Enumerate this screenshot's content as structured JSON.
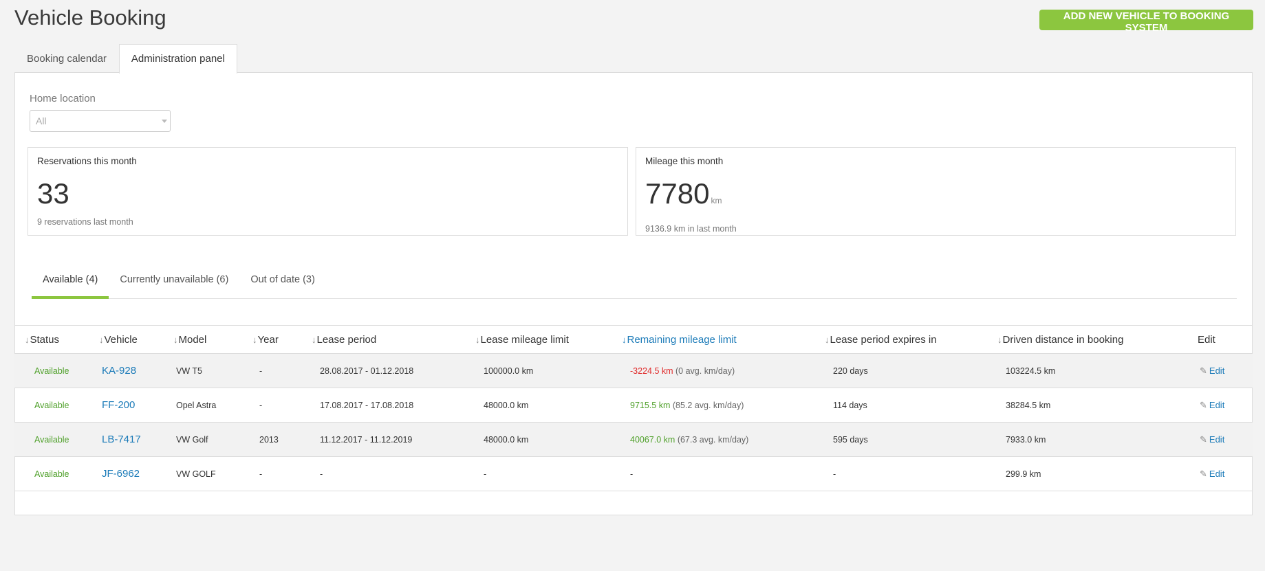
{
  "header": {
    "title": "Vehicle Booking",
    "add_button": "ADD NEW VEHICLE TO BOOKING SYSTEM"
  },
  "main_tabs": [
    {
      "label": "Booking calendar",
      "active": false
    },
    {
      "label": "Administration panel",
      "active": true
    }
  ],
  "filter": {
    "label": "Home location",
    "value": "All"
  },
  "stats": {
    "reservations": {
      "label": "Reservations this month",
      "value": "33",
      "sub": "9 reservations last month"
    },
    "mileage": {
      "label": "Mileage this month",
      "value": "7780",
      "unit": "km",
      "sub": "9136.9 km in last month"
    }
  },
  "sub_tabs": [
    {
      "label": "Available (4)",
      "active": true
    },
    {
      "label": "Currently unavailable (6)",
      "active": false
    },
    {
      "label": "Out of date (3)",
      "active": false
    }
  ],
  "table": {
    "sort_arrow": "↓",
    "columns": [
      {
        "label": "Status",
        "sortable": true
      },
      {
        "label": "Vehicle",
        "sortable": true
      },
      {
        "label": "Model",
        "sortable": true
      },
      {
        "label": "Year",
        "sortable": true
      },
      {
        "label": "Lease period",
        "sortable": true
      },
      {
        "label": "Lease mileage limit",
        "sortable": true
      },
      {
        "label": "Remaining mileage limit",
        "sortable": true,
        "sorted": true
      },
      {
        "label": "Lease period expires in",
        "sortable": true
      },
      {
        "label": "Driven distance in booking",
        "sortable": true
      },
      {
        "label": "Edit",
        "sortable": false
      }
    ],
    "rows": [
      {
        "status": "Available",
        "vehicle": "KA-928",
        "model": "VW T5",
        "year": "-",
        "lease_period": "28.08.2017 - 01.12.2018",
        "lease_limit": "100000.0 km",
        "remaining": "-3224.5 km",
        "remaining_state": "neg",
        "avg": "(0 avg. km/day)",
        "expires": "220 days",
        "driven": "103224.5 km",
        "edit": "Edit"
      },
      {
        "status": "Available",
        "vehicle": "FF-200",
        "model": "Opel Astra",
        "year": "-",
        "lease_period": "17.08.2017 - 17.08.2018",
        "lease_limit": "48000.0 km",
        "remaining": "9715.5 km",
        "remaining_state": "pos",
        "avg": "(85.2 avg. km/day)",
        "expires": "114 days",
        "driven": "38284.5 km",
        "edit": "Edit"
      },
      {
        "status": "Available",
        "vehicle": "LB-7417",
        "model": "VW Golf",
        "year": "2013",
        "lease_period": "11.12.2017 - 11.12.2019",
        "lease_limit": "48000.0 km",
        "remaining": "40067.0 km",
        "remaining_state": "pos",
        "avg": "(67.3 avg. km/day)",
        "expires": "595 days",
        "driven": "7933.0 km",
        "edit": "Edit"
      },
      {
        "status": "Available",
        "vehicle": "JF-6962",
        "model": "VW GOLF",
        "year": "-",
        "lease_period": "-",
        "lease_limit": "-",
        "remaining": "-",
        "remaining_state": "none",
        "avg": "",
        "expires": "-",
        "driven": "299.9 km",
        "edit": "Edit"
      }
    ]
  },
  "colors": {
    "accent_green": "#8cc63f",
    "link_blue": "#1a7ab8",
    "negative_red": "#e02a2a",
    "positive_green": "#4fa02a"
  },
  "icons": {
    "sort": "arrow-down-icon",
    "edit": "pencil-icon",
    "select": "chevron-down-icon"
  }
}
